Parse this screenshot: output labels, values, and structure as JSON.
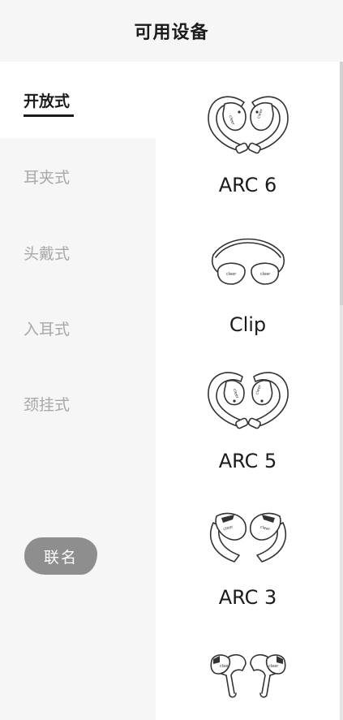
{
  "header": {
    "title": "可用设备"
  },
  "categories": [
    {
      "label": "开放式",
      "active": true
    },
    {
      "label": "耳夹式",
      "active": false
    },
    {
      "label": "头戴式",
      "active": false
    },
    {
      "label": "入耳式",
      "active": false
    },
    {
      "label": "颈挂式",
      "active": false
    }
  ],
  "cobrand": {
    "label": "联名"
  },
  "devices": [
    {
      "name": "ARC 6",
      "image_icon": "arc6-earbuds-icon"
    },
    {
      "name": "Clip",
      "image_icon": "clip-earbuds-icon"
    },
    {
      "name": "ARC 5",
      "image_icon": "arc5-earbuds-icon"
    },
    {
      "name": "ARC 3",
      "image_icon": "arc3-earbuds-icon"
    },
    {
      "name": "",
      "image_icon": "open-earbuds-icon"
    }
  ]
}
